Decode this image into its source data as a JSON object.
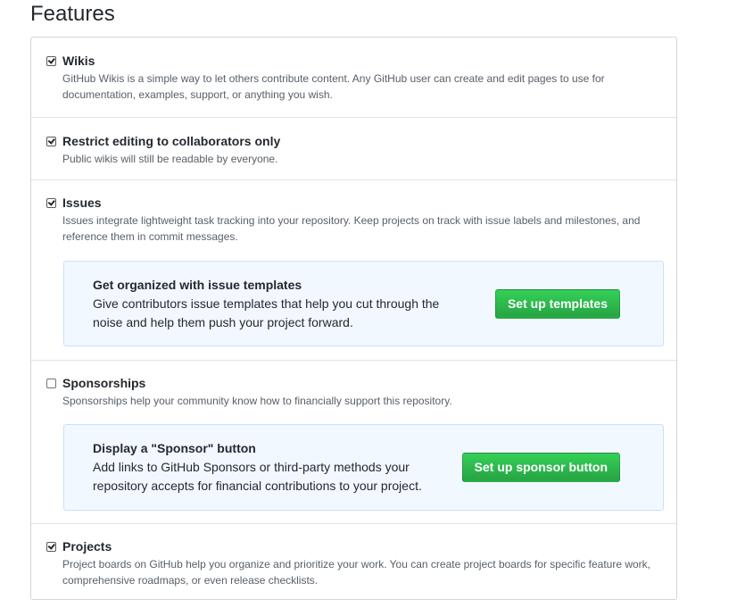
{
  "page": {
    "title": "Features"
  },
  "features": {
    "wikis": {
      "checked": true,
      "title": "Wikis",
      "description": "GitHub Wikis is a simple way to let others contribute content. Any GitHub user can create and edit pages to use for documentation, examples, support, or anything you wish."
    },
    "restrict_editing": {
      "checked": true,
      "title": "Restrict editing to collaborators only",
      "description": "Public wikis will still be readable by everyone."
    },
    "issues": {
      "checked": true,
      "title": "Issues",
      "description": "Issues integrate lightweight task tracking into your repository. Keep projects on track with issue labels and milestones, and reference them in commit messages.",
      "callout": {
        "title": "Get organized with issue templates",
        "text": "Give contributors issue templates that help you cut through the noise and help them push your project forward.",
        "button_label": "Set up templates"
      }
    },
    "sponsorships": {
      "checked": false,
      "title": "Sponsorships",
      "description": "Sponsorships help your community know how to financially support this repository.",
      "callout": {
        "title": "Display a \"Sponsor\" button",
        "text": "Add links to GitHub Sponsors or third-party methods your repository accepts for financial contributions to your project.",
        "button_label": "Set up sponsor button"
      }
    },
    "projects": {
      "checked": true,
      "title": "Projects",
      "description": "Project boards on GitHub help you organize and prioritize your work. You can create project boards for specific feature work, comprehensive roadmaps, or even release checklists."
    }
  },
  "colors": {
    "primary_button": "#28a745",
    "callout_background": "#f1f8ff",
    "callout_border": "#c8e1ff",
    "description_text": "#586069"
  }
}
